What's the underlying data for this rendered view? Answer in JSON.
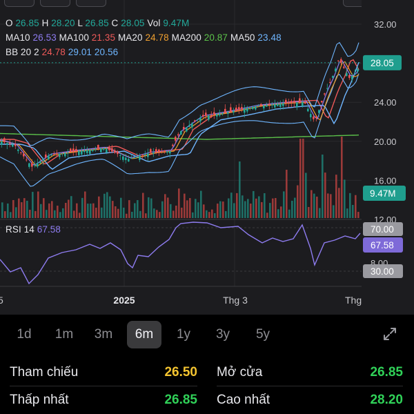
{
  "legend": {
    "ohlc": [
      {
        "k": "O",
        "v": "26.85"
      },
      {
        "k": "H",
        "v": "28.20"
      },
      {
        "k": "L",
        "v": "26.85"
      },
      {
        "k": "C",
        "v": "28.05"
      },
      {
        "k": "Vol",
        "v": "9.47M"
      }
    ],
    "ma": [
      {
        "k": "MA10",
        "v": "26.53"
      },
      {
        "k": "MA100",
        "v": "21.35"
      },
      {
        "k": "MA20",
        "v": "24.78"
      },
      {
        "k": "MA200",
        "v": "20.87"
      },
      {
        "k": "MA50",
        "v": "23.48"
      }
    ],
    "bb": {
      "k": "BB 20 2",
      "upper": "24.78",
      "mid": "29.01",
      "lower": "20.56"
    },
    "rsi": {
      "k": "RSI 14",
      "v": "67.58"
    }
  },
  "colors": {
    "ohlc": "#22a99a",
    "ma10": "#8e7cf0",
    "ma100": "#f05a5a",
    "ma20": "#f0a030",
    "ma200": "#5cc24a",
    "ma50": "#6fb6ff",
    "bb_upper": "#f05a5a",
    "bb_mid": "#6fb6ff",
    "bb_lower": "#6fb6ff",
    "rsi": "#8e7cf0",
    "up": "#22a99a",
    "down": "#ef5350",
    "price_tag": "#1f9e8e",
    "rsi_tag": "#7e6ad8",
    "tab_active_bg": "#3a3a3c",
    "stat_yellow": "#f4c430",
    "stat_green": "#30d158"
  },
  "price_axis": {
    "ticks": [
      "32.00",
      "28.00",
      "24.00",
      "20.00",
      "16.00",
      "12.00"
    ],
    "last_price_tag": "28.05",
    "volume_tag": "9.47M"
  },
  "rsi_axis": {
    "ticks": [
      "70.00",
      "8.00"
    ],
    "value_tag": "67.58",
    "lower_tag": "30.00",
    "upper_tag": "70.00"
  },
  "time_axis": [
    "5",
    "2025",
    "Thg 3",
    "Thg"
  ],
  "chart_data": {
    "type": "candlestick",
    "price_range": [
      12,
      33
    ],
    "last_price": 28.05,
    "reference_lines": {
      "last_price": 28.05
    },
    "rsi_value": 67.58,
    "rsi_levels": [
      30,
      70
    ],
    "grid": true
  },
  "tabs": [
    {
      "label": "1d",
      "active": false
    },
    {
      "label": "1m",
      "active": false
    },
    {
      "label": "3m",
      "active": false
    },
    {
      "label": "6m",
      "active": true
    },
    {
      "label": "1y",
      "active": false
    },
    {
      "label": "3y",
      "active": false
    },
    {
      "label": "5y",
      "active": false
    }
  ],
  "expand_icon": "expand-arrows-icon",
  "stats": [
    {
      "label": "Tham chiếu",
      "value": "26.50",
      "color": "#f4c430"
    },
    {
      "label": "Mở cửa",
      "value": "26.85",
      "color": "#30d158"
    },
    {
      "label": "Thấp nhất",
      "value": "26.85",
      "color": "#30d158"
    },
    {
      "label": "Cao nhất",
      "value": "28.20",
      "color": "#30d158"
    }
  ]
}
